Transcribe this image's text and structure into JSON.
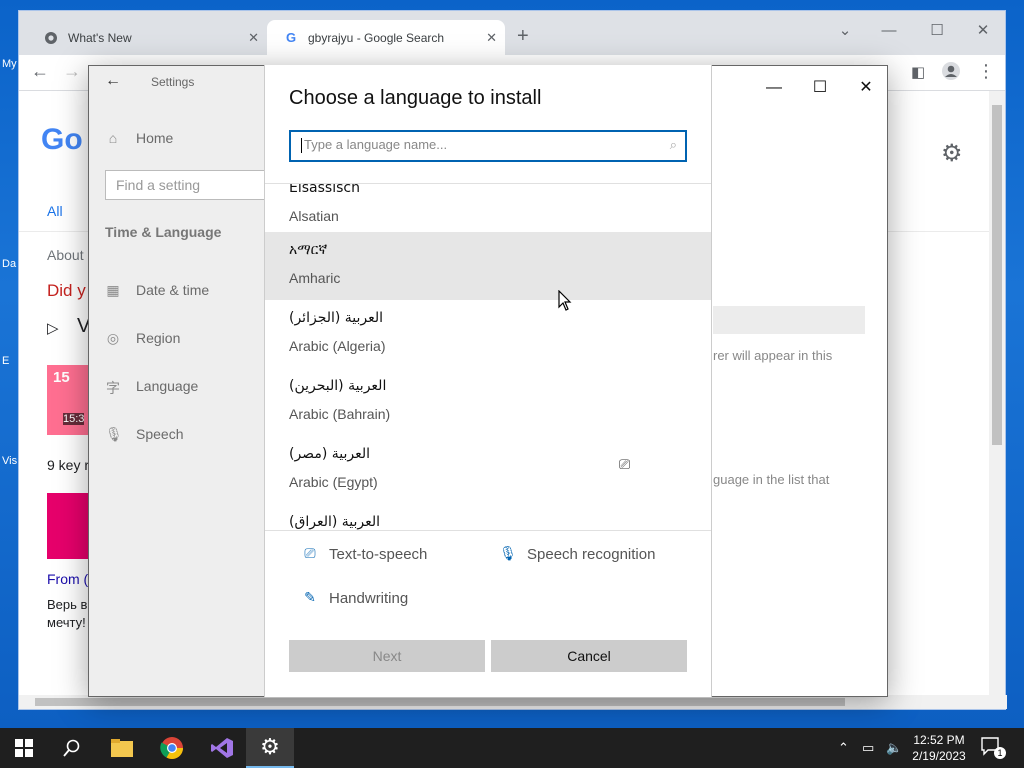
{
  "desktop": {
    "labels": [
      "My",
      "Da",
      "E",
      "Vis"
    ]
  },
  "chrome": {
    "tabs": [
      {
        "title": "What's New",
        "active": false
      },
      {
        "title": "gbyrajyu - Google Search",
        "active": true
      }
    ],
    "page": {
      "logo": "Go",
      "tab_all": "All",
      "about": "About",
      "did_you": "Did y",
      "video_prefix": "V",
      "thumb1_text": "15",
      "thumb1_time": "15:3",
      "key_text": "9 key r",
      "from_text": "From (",
      "russian_1": "Верь в",
      "russian_2": "мечту!"
    }
  },
  "settings": {
    "header": "Settings",
    "home": "Home",
    "find_placeholder": "Find a setting",
    "section": "Time & Language",
    "nav": [
      "Date & time",
      "Region",
      "Language",
      "Speech"
    ],
    "bg_text_1": "rer will appear in this",
    "bg_text_2": "guage in the list that"
  },
  "dialog": {
    "title": "Choose a language to install",
    "search_placeholder": "Type a language name...",
    "languages": [
      {
        "native": "Elsässisch",
        "english": "Alsatian"
      },
      {
        "native": "አማርኛ",
        "english": "Amharic",
        "selected": true
      },
      {
        "native": "العربية (الجزائر)",
        "english": "Arabic (Algeria)"
      },
      {
        "native": "العربية (البحرين)",
        "english": "Arabic (Bahrain)"
      },
      {
        "native": "العربية (مصر)",
        "english": "Arabic (Egypt)"
      },
      {
        "native": "العربية (العراق)",
        "english": ""
      }
    ],
    "features": {
      "tts": "Text-to-speech",
      "speech": "Speech recognition",
      "handwriting": "Handwriting"
    },
    "next_label": "Next",
    "cancel_label": "Cancel"
  },
  "taskbar": {
    "time": "12:52 PM",
    "date": "2/19/2023",
    "notifications": "1"
  },
  "colors": {
    "accent": "#0063b1",
    "selected_row": "#e6e6e6",
    "taskbar": "#1f1f1f"
  }
}
